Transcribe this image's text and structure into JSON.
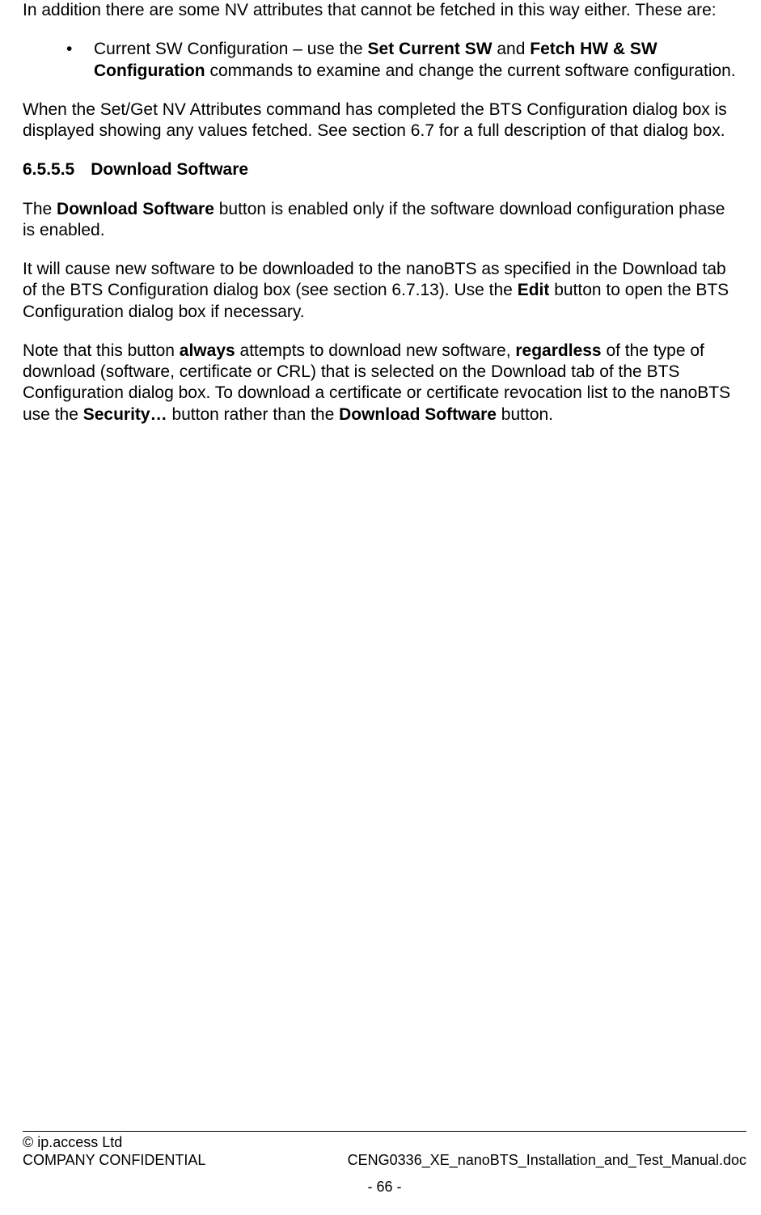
{
  "intro_para": "In addition there are some NV attributes that cannot be fetched in this way either. These are:",
  "bullet": {
    "lead": "Current SW Configuration – use the ",
    "bold1": "Set Current SW",
    "mid": " and ",
    "bold2": "Fetch HW & SW Configuration",
    "tail": " commands to examine and change the current software configuration."
  },
  "para2": "When the Set/Get NV Attributes command has completed the BTS Configuration dialog box is displayed showing any values fetched. See section 6.7 for a full description of that dialog box.",
  "heading": {
    "number": "6.5.5.5",
    "title": "Download Software"
  },
  "para3": {
    "pre": "The ",
    "bold": "Download Software",
    "post": " button is enabled only if the software download configuration phase is enabled."
  },
  "para4": {
    "pre": "It will cause new software to be downloaded to the nanoBTS as specified in the Download tab of the BTS Configuration dialog box (see section 6.7.13). Use the ",
    "bold": "Edit",
    "post": " button to open the BTS Configuration dialog box if necessary."
  },
  "para5": {
    "s1": "Note that this button ",
    "b1": "always",
    "s2": " attempts to download new software, ",
    "b2": "regardless",
    "s3": " of the type of download (software, certificate or CRL) that is selected on the Download tab of the BTS Configuration dialog box. To download a certificate or certificate revocation list to the nanoBTS use the ",
    "b3": "Security…",
    "s4": " button rather than the ",
    "b4": "Download Software",
    "s5": " button."
  },
  "footer": {
    "copyright": "© ip.access Ltd",
    "confidential": "COMPANY CONFIDENTIAL",
    "docname": "CENG0336_XE_nanoBTS_Installation_and_Test_Manual.doc",
    "page": "- 66 -"
  }
}
